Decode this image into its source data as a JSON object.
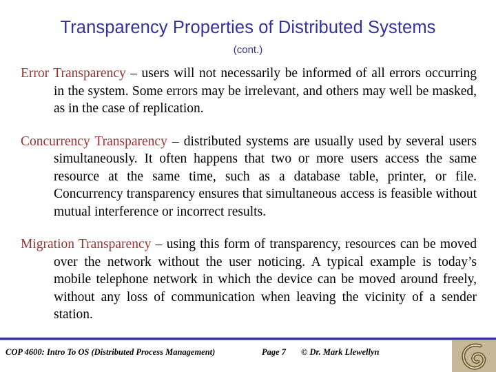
{
  "slide": {
    "title": "Transparency Properties of Distributed Systems",
    "subtitle": "(cont.)",
    "paragraphs": [
      {
        "term": "Error Transparency",
        "text": " – users will not necessarily be informed of all errors occurring in the system.  Some errors may be irrelevant, and others may well be masked, as in the case of replication."
      },
      {
        "term": "Concurrency Transparency",
        "text": " – distributed systems are usually used by several users simultaneously.   It often happens that two or more users access the same resource at the same time, such as a database table, printer, or file.    Concurrency transparency ensures that simultaneous access is feasible without mutual interference or incorrect results."
      },
      {
        "term": "Migration Transparency",
        "text": " – using this form of transparency, resources can be moved over the network without the user noticing.  A typical example is today’s mobile telephone network in which the device can be moved around freely, without any loss of communication when leaving the vicinity of a sender station."
      }
    ]
  },
  "footer": {
    "course": "COP 4600: Intro To OS  (Distributed Process Management)",
    "page": "Page 7",
    "credit": "© Dr. Mark Llewellyn"
  },
  "colors": {
    "title": "#333399",
    "term": "#993333",
    "rule": "#333399",
    "logo_bg": "#c8b89a",
    "logo_fg": "#6b5a2a"
  }
}
